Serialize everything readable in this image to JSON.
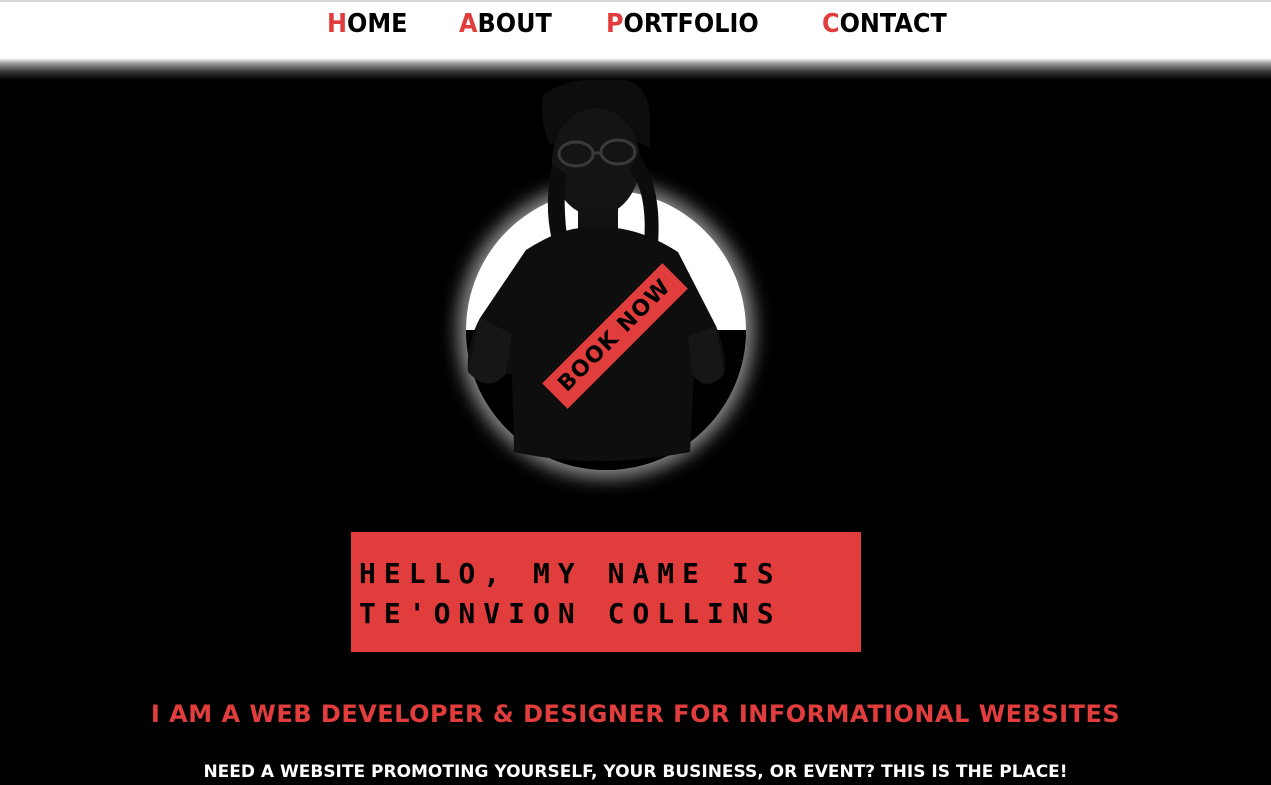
{
  "nav": {
    "items": [
      {
        "first": "H",
        "rest": "OME"
      },
      {
        "first": "A",
        "rest": "BOUT"
      },
      {
        "first": "P",
        "rest": "ORTFOLIO"
      },
      {
        "first": "C",
        "rest": "ONTACT"
      }
    ]
  },
  "hero": {
    "portrait_icon": "person-portrait",
    "book_now_label": "BOOK NOW",
    "name_line1": "HELLO, MY NAME IS",
    "name_line2": "TE'ONVION COLLINS",
    "tagline": "I AM A WEB DEVELOPER & DESIGNER FOR INFORMATIONAL WEBSITES",
    "subline": "NEED A WEBSITE PROMOTING YOURSELF, YOUR BUSINESS, OR EVENT? THIS IS THE PLACE!"
  },
  "colors": {
    "accent": "#e23d3d",
    "background": "#000000",
    "navbar": "#ffffff"
  }
}
